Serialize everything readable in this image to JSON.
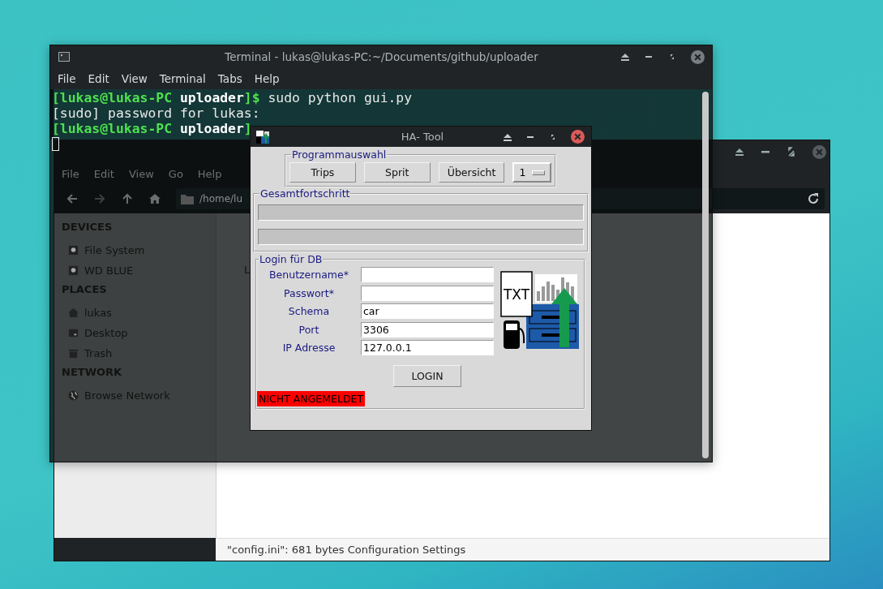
{
  "terminal": {
    "title": "Terminal - lukas@lukas-PC:~/Documents/github/uploader",
    "menu": [
      "File",
      "Edit",
      "View",
      "Terminal",
      "Tabs",
      "Help"
    ],
    "lines": [
      {
        "kind": "prompt",
        "user": "[lukas@lukas-PC",
        "dir": "uploader",
        "end": "]$",
        "command": "sudo python gui.py"
      },
      {
        "kind": "output",
        "text": "[sudo] password for lukas:"
      },
      {
        "kind": "prompt",
        "user": "[lukas@lukas-PC",
        "dir": "uploader",
        "end": "]"
      }
    ]
  },
  "file_manager": {
    "menu": [
      "File",
      "Edit",
      "View",
      "Go",
      "Help"
    ],
    "path": "/home/lu",
    "sidebar": [
      {
        "heading": "DEVICES",
        "items": [
          {
            "label": "File System",
            "kind": "drive"
          },
          {
            "label": "WD BLUE",
            "kind": "drive"
          }
        ]
      },
      {
        "heading": "PLACES",
        "items": [
          {
            "label": "lukas",
            "kind": "home"
          },
          {
            "label": "Desktop",
            "kind": "desktop"
          },
          {
            "label": "Trash",
            "kind": "trash"
          }
        ]
      },
      {
        "heading": "NETWORK",
        "items": [
          {
            "label": "Browse Network",
            "kind": "network"
          }
        ]
      }
    ],
    "file_view_text": "L",
    "status_bar": "\"config.ini\": 681 bytes Configuration Settings"
  },
  "ha_tool": {
    "title": "HA- Tool",
    "program_group": {
      "title": "Programmauswahl",
      "buttons": [
        "Trips",
        "Sprit",
        "Übersicht"
      ],
      "option_menu": "1"
    },
    "progress_group": {
      "title": "Gesamtfortschritt",
      "bars": [
        {
          "level": 0
        },
        {
          "level": 0
        }
      ]
    },
    "login_group": {
      "title": "Login für DB",
      "fields": [
        {
          "label": "Benutzername*"
        },
        {
          "label": "Passwort*"
        },
        {
          "label": "Schema",
          "value": "car"
        },
        {
          "label": "Port",
          "value": "3306"
        },
        {
          "label": "IP Adresse",
          "value": "127.0.0.1"
        }
      ],
      "logo_text": "TXT",
      "button": "LOGIN",
      "status": {
        "text": "NICHT ANGEMELDET",
        "logged_in": false
      }
    }
  }
}
